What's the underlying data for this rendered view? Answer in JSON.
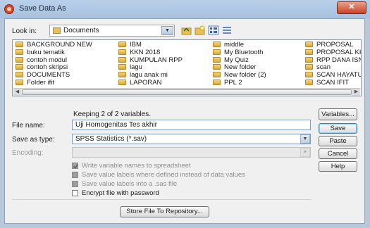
{
  "window": {
    "title": "Save Data As",
    "close_glyph": "✕"
  },
  "lookin": {
    "label": "Look in:",
    "value": "Documents",
    "icons": [
      "folder-icon",
      "up-folder-icon",
      "new-folder-icon",
      "list-view-icon",
      "details-view-icon"
    ]
  },
  "files": {
    "columns": [
      [
        "BACKGROUND NEW",
        "buku tematik",
        "contoh modul",
        "contoh skripsi",
        "DOCUMENTS",
        "Folder ifit"
      ],
      [
        "IBM",
        "KKN 2018",
        "KUMPULAN RPP",
        "lagu",
        "lagu anak mi",
        "LAPORAN"
      ],
      [
        "middle",
        "My Bluetooth",
        "My Quiz",
        "New folder",
        "New folder (2)",
        "PPL 2"
      ],
      [
        "PROPOSAL",
        "PROPOSAL KK",
        "RPP DANA ISN",
        "scan",
        "SCAN HAYATU",
        "SCAN IFIT"
      ]
    ]
  },
  "form": {
    "keeping_text": "Keeping 2 of 2 variables.",
    "file_name_label": "File name:",
    "file_name_value": "Uji Homogenitas Tes akhir",
    "save_type_label": "Save as type:",
    "save_type_value": "SPSS Statistics (*.sav)",
    "encoding_label": "Encoding:",
    "encoding_value": ""
  },
  "options": [
    {
      "label": "Write variable names to spreadsheet",
      "checked": true,
      "disabled": true
    },
    {
      "label": "Save value labels where defined instead of data values",
      "checked": false,
      "disabled": true
    },
    {
      "label": "Save value labels into a .sas file",
      "checked": false,
      "disabled": true
    },
    {
      "label": "Encrypt file with password",
      "checked": false,
      "disabled": false
    }
  ],
  "buttons": {
    "variables": "Variables...",
    "save": "Save",
    "paste": "Paste",
    "cancel": "Cancel",
    "help": "Help",
    "repository": "Store File To Repository..."
  },
  "colors": {
    "titlebar": "#a6c0de",
    "close": "#c8432a",
    "folder": "#e6c15a"
  }
}
